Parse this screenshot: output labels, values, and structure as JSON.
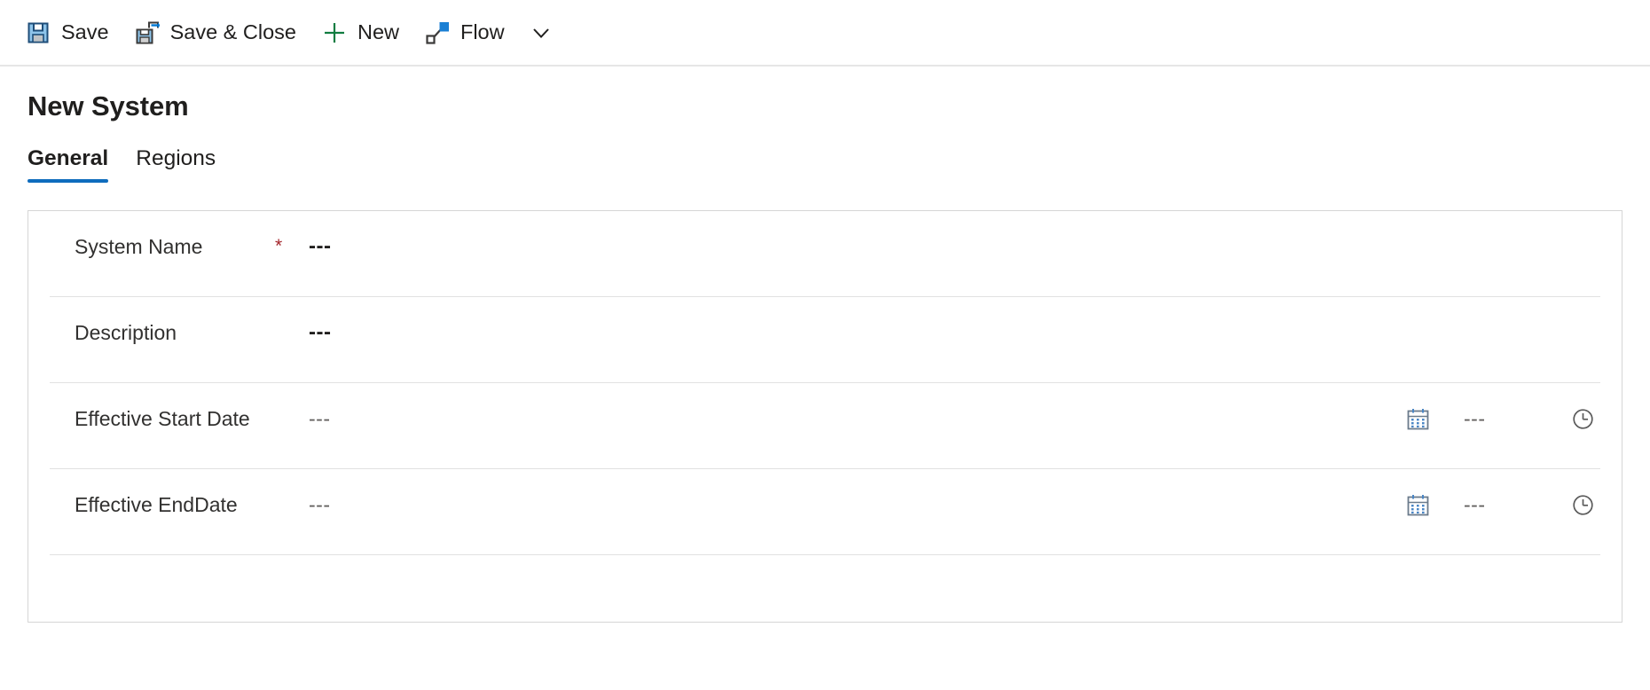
{
  "commandbar": {
    "buttons": [
      {
        "id": "save",
        "label": "Save",
        "icon": "save-floppy-icon"
      },
      {
        "id": "save-close",
        "label": "Save & Close",
        "icon": "save-and-close-icon"
      },
      {
        "id": "new",
        "label": "New",
        "icon": "plus-icon"
      },
      {
        "id": "flow",
        "label": "Flow",
        "icon": "flow-nodes-icon"
      }
    ],
    "overflow_icon": "chevron-down-icon"
  },
  "page": {
    "title": "New System"
  },
  "tabs": [
    {
      "id": "general",
      "label": "General",
      "active": true
    },
    {
      "id": "regions",
      "label": "Regions",
      "active": false
    }
  ],
  "form": {
    "rows": [
      {
        "id": "system-name",
        "label": "System Name",
        "required_marker": "*",
        "value": "---",
        "has_date": false
      },
      {
        "id": "description",
        "label": "Description",
        "required_marker": "",
        "value": "---",
        "has_date": false
      },
      {
        "id": "effective-start-date",
        "label": "Effective Start Date",
        "required_marker": "",
        "value": "---",
        "has_date": true,
        "date_icon": "calendar-icon",
        "time_value": "---",
        "time_icon": "clock-icon"
      },
      {
        "id": "effective-end-date",
        "label": "Effective EndDate",
        "required_marker": "",
        "value": "---",
        "has_date": true,
        "date_icon": "calendar-icon",
        "time_value": "---",
        "time_icon": "clock-icon"
      }
    ]
  },
  "colors": {
    "accent": "#0f6cbd",
    "required": "#a4262c",
    "icon_blue": "#0078d4",
    "icon_dark": "#3b3a39",
    "new_green": "#107c41",
    "panel_border": "#d6d6d6",
    "row_divider": "#e1e1e1"
  }
}
